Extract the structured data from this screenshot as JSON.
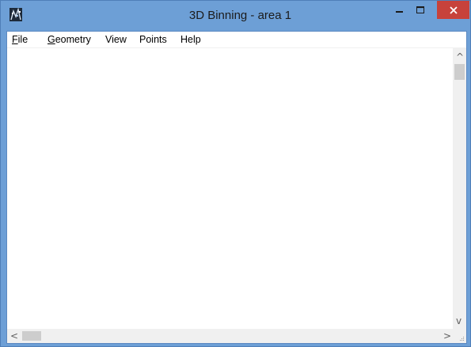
{
  "window": {
    "title": "3D Binning - area 1",
    "controls": {
      "minimize": "minimize-icon",
      "maximize": "maximize-icon",
      "close": "close-icon"
    },
    "colors": {
      "frame": "#6d9fd6",
      "close": "#c7423b",
      "client": "#ffffff"
    }
  },
  "menu": {
    "items": [
      {
        "id": "file",
        "label": "File",
        "mnemonic": "F",
        "rest": "ile"
      },
      {
        "id": "geometry",
        "label": "Geometry",
        "mnemonic": "G",
        "rest": "eometry"
      },
      {
        "id": "view",
        "label": "View",
        "mnemonic": "",
        "rest": "View"
      },
      {
        "id": "points",
        "label": "Points",
        "mnemonic": "",
        "rest": "Points"
      },
      {
        "id": "help",
        "label": "Help",
        "mnemonic": "",
        "rest": "Help"
      }
    ]
  },
  "scrollbars": {
    "vertical": {
      "up": "^",
      "down": "v"
    },
    "horizontal": {
      "left": "<",
      "right": ">"
    }
  }
}
